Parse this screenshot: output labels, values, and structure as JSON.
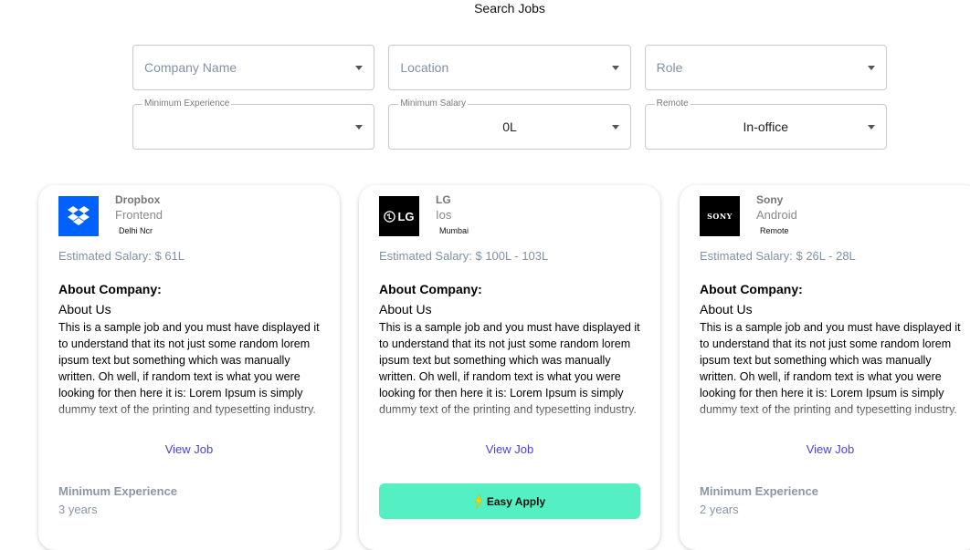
{
  "page": {
    "title": "Search Jobs"
  },
  "filters": {
    "company_name": {
      "placeholder": "Company Name"
    },
    "location": {
      "placeholder": "Location"
    },
    "role": {
      "placeholder": "Role"
    },
    "min_experience": {
      "label": "Minimum Experience",
      "value": ""
    },
    "min_salary": {
      "label": "Minimum Salary",
      "value": "0L"
    },
    "remote": {
      "label": "Remote",
      "value": "In-office"
    }
  },
  "jobs": [
    {
      "company": "Dropbox",
      "role": "Frontend",
      "location": "Delhi Ncr",
      "logo": "dropbox-logo",
      "salary": "Estimated Salary: $ 61L",
      "about_heading": "About Company:",
      "about_sub": "About Us",
      "about_text": "This is a sample job and you must have displayed it to understand that its not just some random lorem ipsum text but something which was manually written. Oh well, if random text is what you were looking for then here it is: Lorem Ipsum is simply dummy text of the printing and typesetting industry.",
      "view_job": "View Job",
      "min_exp_label": "Minimum Experience",
      "min_exp_value": "3 years"
    },
    {
      "company": "LG",
      "role": "Ios",
      "location": "Mumbai",
      "logo": "lg-logo",
      "logo_text": "LG",
      "salary": "Estimated Salary: $ 100L - 103L",
      "about_heading": "About Company:",
      "about_sub": "About Us",
      "about_text": "This is a sample job and you must have displayed it to understand that its not just some random lorem ipsum text but something which was manually written. Oh well, if random text is what you were looking for then here it is: Lorem Ipsum is simply dummy text of the printing and typesetting industry.",
      "view_job": "View Job",
      "easy_apply": "Easy Apply",
      "easy_apply_icon": "lightning-icon"
    },
    {
      "company": "Sony",
      "role": "Android",
      "location": "Remote",
      "logo": "sony-logo",
      "logo_text": "SONY",
      "salary": "Estimated Salary: $ 26L - 28L",
      "about_heading": "About Company:",
      "about_sub": "About Us",
      "about_text": "This is a sample job and you must have displayed it to understand that its not just some random lorem ipsum text but something which was manually written. Oh well, if random text is what you were looking for then here it is: Lorem Ipsum is simply dummy text of the printing and typesetting industry.",
      "view_job": "View Job",
      "min_exp_label": "Minimum Experience",
      "min_exp_value": "2 years"
    }
  ],
  "colors": {
    "accent_link": "#4943da",
    "easy_apply_bg": "#54efc3",
    "dropbox_blue": "#0061fe",
    "lightning": "#f5d800"
  }
}
